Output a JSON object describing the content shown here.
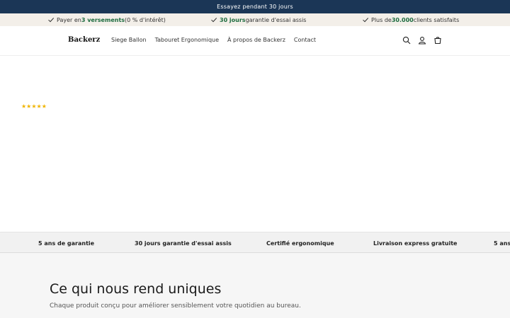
{
  "announcement": "Essayez pendant 30 jours",
  "benefits": [
    {
      "pre": "Payer en ",
      "strong": "3 versements",
      "post": " (0 % d'intérêt)"
    },
    {
      "pre": "",
      "strong": "30 jours",
      "post": " garantie d'essai assis"
    },
    {
      "pre": "Plus de ",
      "strong": "30.000",
      "post": " clients satisfaits"
    }
  ],
  "header": {
    "logo": "Backerz",
    "nav": [
      "Siege Ballon",
      "Tabouret Ergonomique",
      "À propos de Backerz",
      "Contact"
    ],
    "icons": [
      "search-icon",
      "account-icon",
      "cart-icon"
    ]
  },
  "hero": {
    "stars": "★★★★★"
  },
  "marquee": [
    "5 ans de garantie",
    "30 jours garantie d'essai assis",
    "Certifié ergonomique",
    "Livraison express gratuite",
    "5 ans"
  ],
  "uniques": {
    "title": "Ce qui nous rend uniques",
    "subtitle": "Chaque produit conçu pour améliorer sensiblement votre quotidien au bureau."
  },
  "colors": {
    "announcement_bg": "#1b3656",
    "benefit_bg": "#f3efe9",
    "accent_green": "#1c6b3e",
    "star": "#f0b400"
  }
}
